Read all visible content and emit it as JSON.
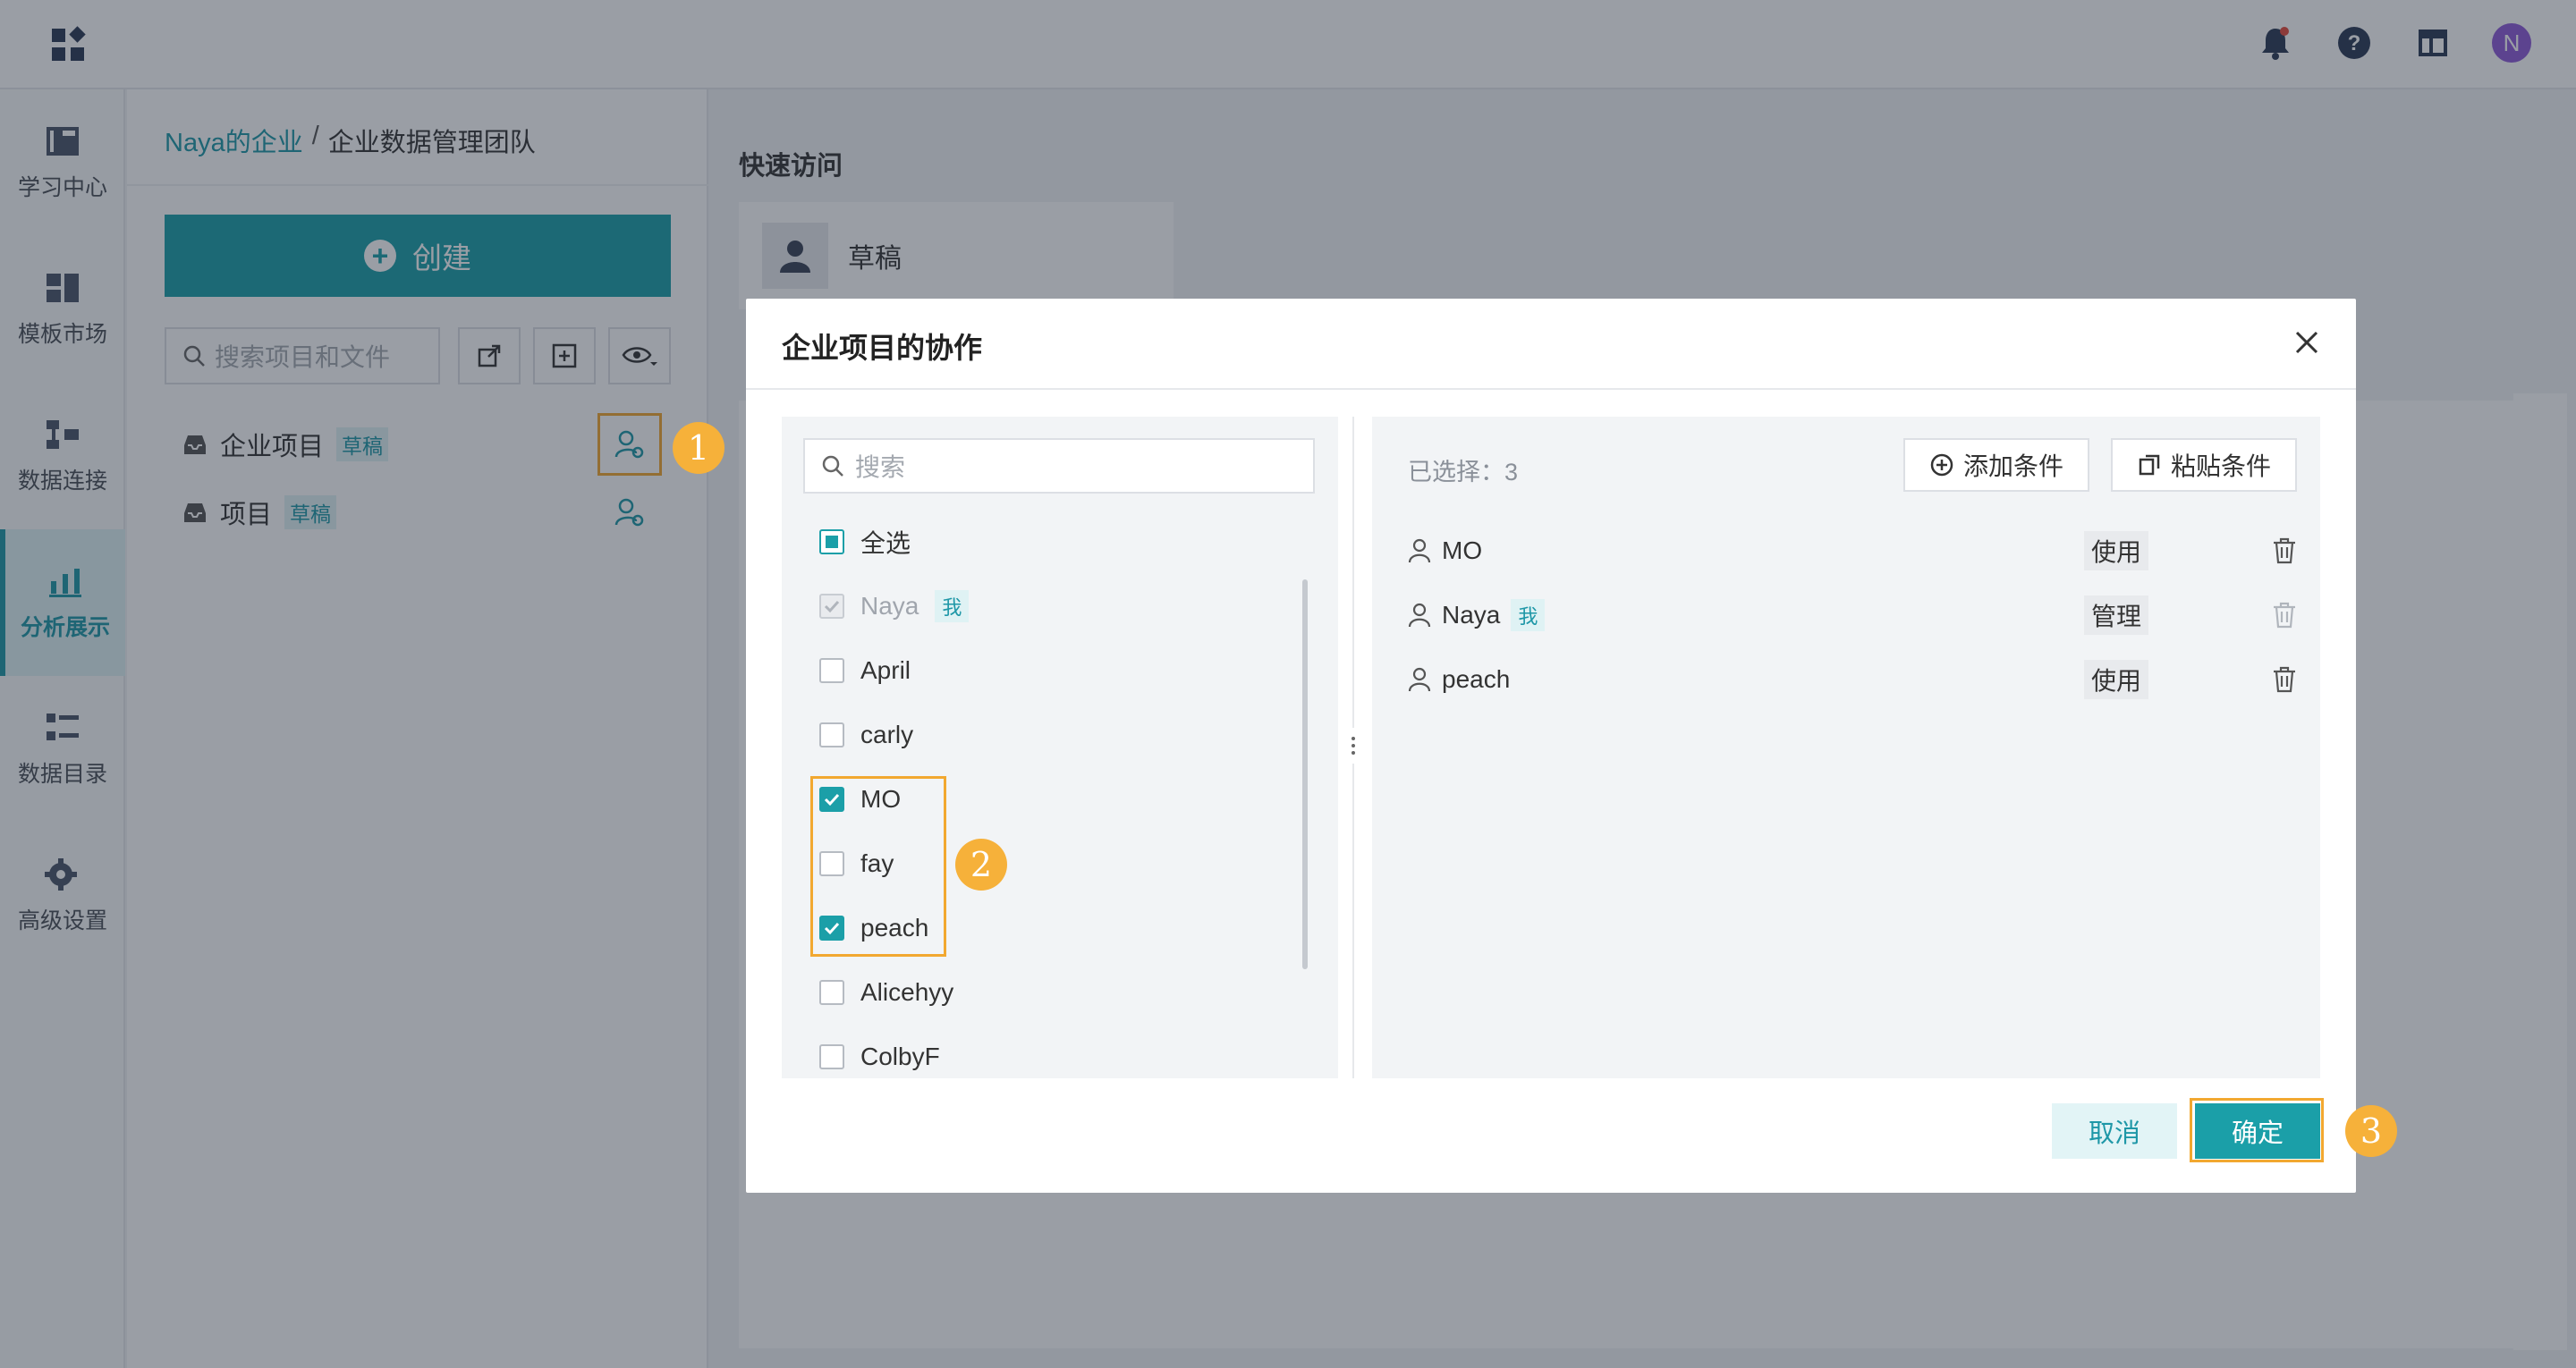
{
  "header": {
    "logo_icon": "apps-grid-icon",
    "icons": [
      "bell-icon",
      "help-icon",
      "layout-icon"
    ],
    "avatar_letter": "N",
    "accent": "#1b9fa8"
  },
  "nav": {
    "items": [
      {
        "label": "学习中心",
        "icon": "book-icon"
      },
      {
        "label": "模板市场",
        "icon": "template-icon"
      },
      {
        "label": "数据连接",
        "icon": "data-connect-icon"
      },
      {
        "label": "分析展示",
        "icon": "analysis-icon",
        "active": true
      },
      {
        "label": "数据目录",
        "icon": "catalog-icon"
      },
      {
        "label": "高级设置",
        "icon": "advanced-settings-icon"
      }
    ]
  },
  "panel": {
    "breadcrumb": {
      "root": "Naya的企业",
      "sep": "/",
      "current": "企业数据管理团队"
    },
    "create_label": "创建",
    "search_placeholder": "搜索项目和文件",
    "tree": [
      {
        "name": "企业项目",
        "tag": "草稿"
      },
      {
        "name": "项目",
        "tag": "草稿"
      }
    ]
  },
  "main": {
    "quick_access_title": "快速访问",
    "quick_card_label": "草稿"
  },
  "dialog": {
    "title": "企业项目的协作",
    "search_placeholder": "搜索",
    "select_all": "全选",
    "me_tag": "我",
    "members": [
      {
        "name": "Naya",
        "me": true,
        "checked": true,
        "disabled": true
      },
      {
        "name": "April",
        "checked": false
      },
      {
        "name": "carly",
        "checked": false
      },
      {
        "name": "MO",
        "checked": true
      },
      {
        "name": "fay",
        "checked": false
      },
      {
        "name": "peach",
        "checked": true
      },
      {
        "name": "Alicehyy",
        "checked": false
      },
      {
        "name": "ColbyF",
        "checked": false
      }
    ],
    "selected_count_label": "已选择：3",
    "add_condition": "添加条件",
    "paste_condition": "粘贴条件",
    "selected": [
      {
        "name": "MO",
        "perm": "使用"
      },
      {
        "name": "Naya",
        "me": true,
        "perm": "管理"
      },
      {
        "name": "peach",
        "perm": "使用"
      }
    ],
    "cancel": "取消",
    "confirm": "确定"
  },
  "steps": [
    "1",
    "2",
    "3"
  ]
}
